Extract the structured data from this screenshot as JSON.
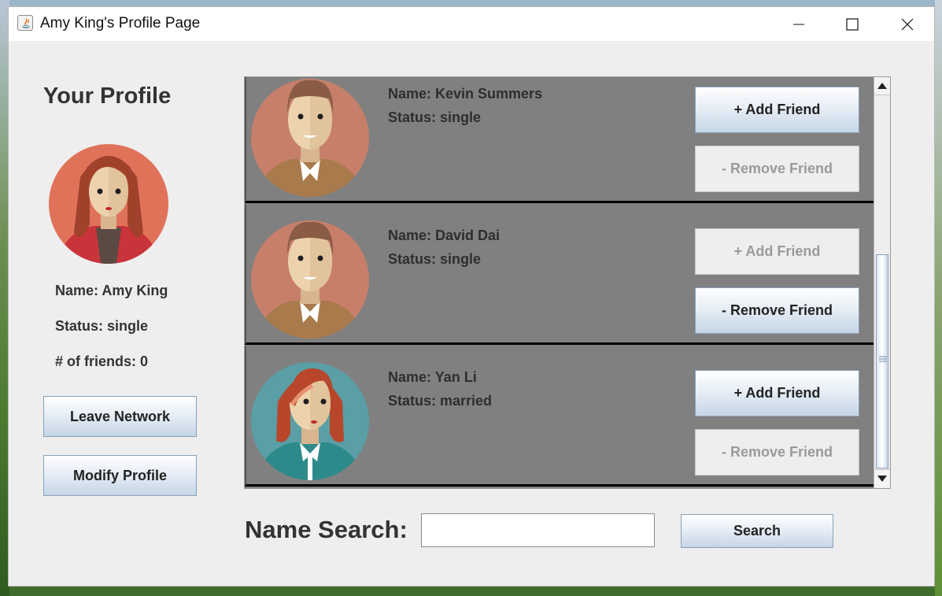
{
  "window": {
    "title": "Amy King's Profile Page"
  },
  "profile": {
    "heading": "Your Profile",
    "name": "Name: Amy King",
    "status": "Status: single",
    "friends": "# of friends: 0",
    "leave_label": "Leave Network",
    "modify_label": "Modify Profile"
  },
  "friends": [
    {
      "name": "Name: Kevin Summers",
      "status": "Status: single",
      "add_label": "+ Add Friend",
      "remove_label": "- Remove Friend",
      "add_enabled": true,
      "remove_enabled": false
    },
    {
      "name": "Name: David Dai",
      "status": "Status: single",
      "add_label": "+ Add Friend",
      "remove_label": "- Remove Friend",
      "add_enabled": false,
      "remove_enabled": true
    },
    {
      "name": "Name: Yan Li",
      "status": "Status: married",
      "add_label": "+ Add Friend",
      "remove_label": "- Remove Friend",
      "add_enabled": true,
      "remove_enabled": false
    }
  ],
  "search": {
    "label": "Name Search:",
    "value": "",
    "button_label": "Search"
  },
  "icons": {
    "app": "java-icon",
    "minimize": "minimize-icon",
    "maximize": "maximize-icon",
    "close": "close-icon",
    "scroll_up": "scroll-up-arrow-icon",
    "scroll_down": "scroll-down-arrow-icon"
  },
  "colors": {
    "window_bg": "#eeeeee",
    "list_bg": "#808080",
    "card_separator": "#000000",
    "button_top": "#ffffff",
    "button_bottom": "#c5d5e6",
    "button_border": "#8aa1b8",
    "disabled_text": "#9a9a9a",
    "text": "#333333"
  }
}
